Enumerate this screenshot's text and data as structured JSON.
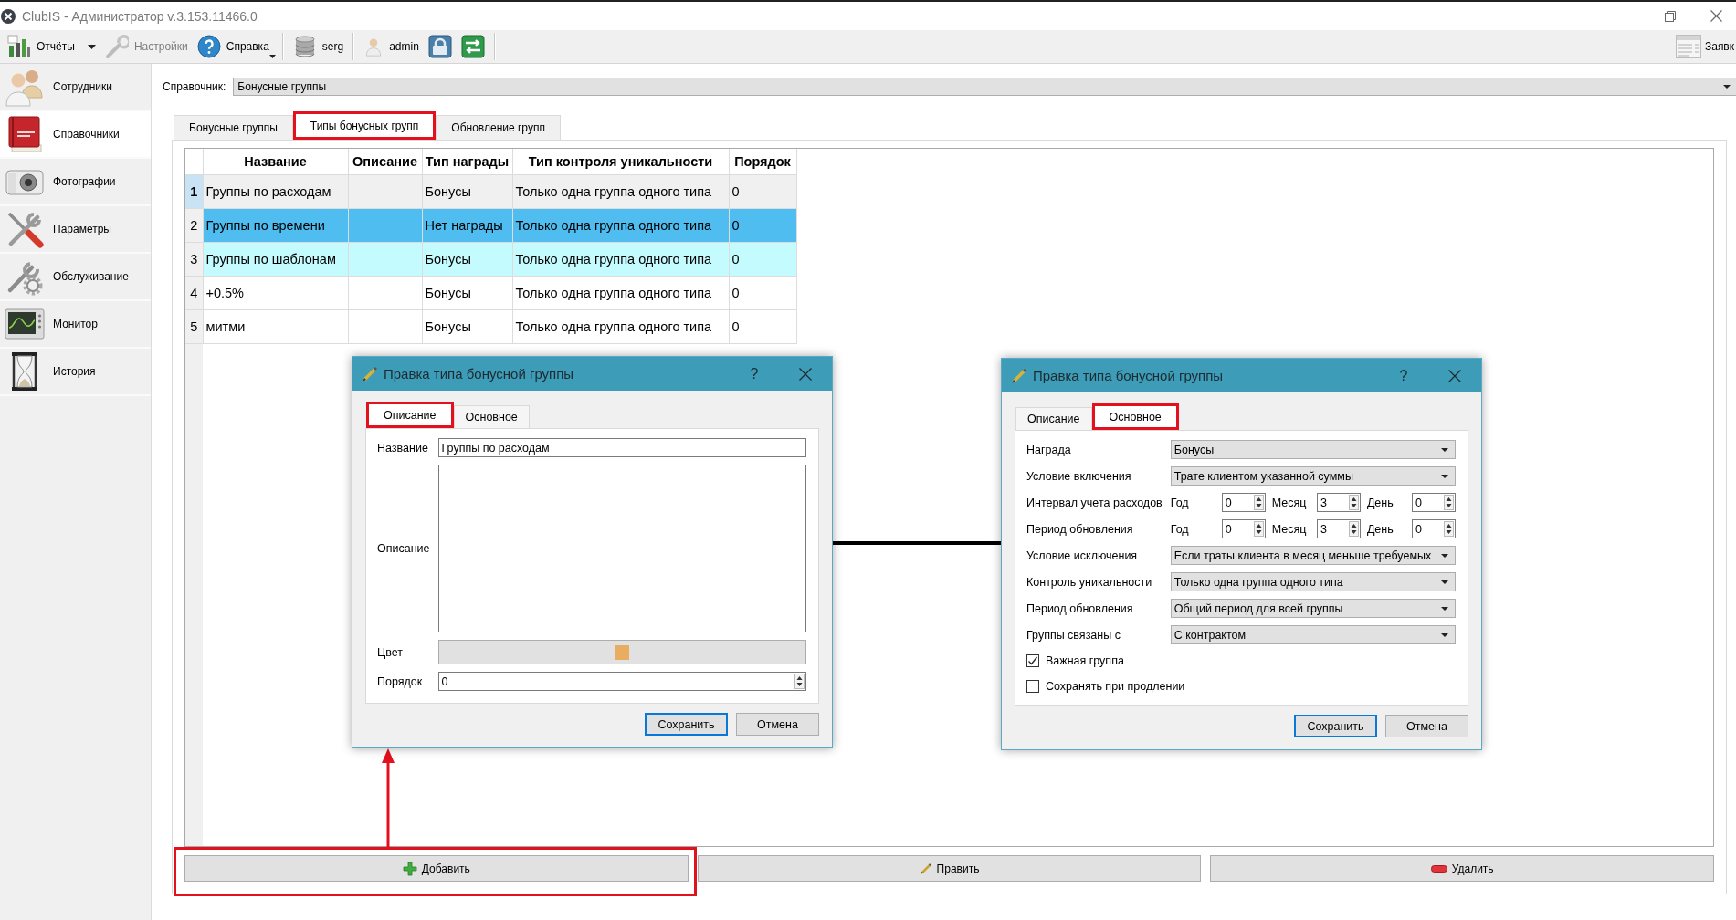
{
  "window": {
    "title": "ClubIS - Администратор v.3.153.11466.0"
  },
  "toolbar": {
    "items": [
      {
        "kind": "dropdown",
        "label": "Отчёты",
        "disabled": false,
        "separator_after": false
      },
      {
        "kind": "button",
        "label": "Настройки",
        "disabled": true,
        "separator_after": false
      },
      {
        "kind": "menu",
        "label": "Справка",
        "disabled": false,
        "separator_after": true
      },
      {
        "kind": "button",
        "label": "serg",
        "disabled": false,
        "separator_after": true
      },
      {
        "kind": "button",
        "label": "admin",
        "disabled": false,
        "separator_after": false
      },
      {
        "kind": "icon",
        "disabled": false,
        "separator_after": false
      },
      {
        "kind": "icon",
        "disabled": false,
        "separator_after": true
      }
    ],
    "right_item": {
      "label": "Заявк"
    }
  },
  "sidebar": {
    "items": [
      {
        "label": "Сотрудники",
        "selected": false
      },
      {
        "label": "Справочники",
        "selected": true
      },
      {
        "label": "Фотографии",
        "selected": false
      },
      {
        "label": "Параметры",
        "selected": false
      },
      {
        "label": "Обслуживание",
        "selected": false
      },
      {
        "label": "Монитор",
        "selected": false
      },
      {
        "label": "История",
        "selected": false
      }
    ]
  },
  "directory": {
    "label": "Справочник:",
    "value": "Бонусные группы"
  },
  "tabs": [
    {
      "label": "Бонусные группы",
      "selected": false,
      "highlighted": false
    },
    {
      "label": "Типы бонусных групп",
      "selected": true,
      "highlighted": true
    },
    {
      "label": "Обновление групп",
      "selected": false,
      "highlighted": false
    }
  ],
  "table": {
    "columns": [
      "Название",
      "Описание",
      "Тип награды",
      "Тип контроля уникальности",
      "Порядок"
    ],
    "rows": [
      {
        "number": "1",
        "name": "Группы по расходам",
        "reward_type": "Бонусы",
        "uniqueness_control": "Только одна группа одного типа",
        "order": "0",
        "current": true,
        "selected": false,
        "hover": false
      },
      {
        "number": "2",
        "name": "Группы по времени",
        "reward_type": "Нет награды",
        "uniqueness_control": "Только одна группа одного типа",
        "order": "0",
        "current": false,
        "selected": true,
        "hover": false
      },
      {
        "number": "3",
        "name": "Группы по шаблонам",
        "reward_type": "Бонусы",
        "uniqueness_control": "Только одна группа одного типа",
        "order": "0",
        "current": false,
        "selected": false,
        "hover": true
      },
      {
        "number": "4",
        "name": "+0.5%",
        "reward_type": "Бонусы",
        "uniqueness_control": "Только одна группа одного типа",
        "order": "0",
        "current": false,
        "selected": false,
        "hover": false
      },
      {
        "number": "5",
        "name": "митми",
        "reward_type": "Бонусы",
        "uniqueness_control": "Только одна группа одного типа",
        "order": "0",
        "current": false,
        "selected": false,
        "hover": false
      }
    ]
  },
  "buttons": [
    {
      "label": "Добавить",
      "highlighted": true
    },
    {
      "label": "Править",
      "highlighted": false
    },
    {
      "label": "Удалить",
      "highlighted": false
    }
  ],
  "dialogs": [
    {
      "title": "Правка типа бонусной группы",
      "help": "?",
      "tabs": [
        {
          "label": "Описание",
          "selected": true,
          "highlighted": true
        },
        {
          "label": "Основное",
          "selected": false,
          "highlighted": false
        }
      ],
      "fields": [
        {
          "kind": "text",
          "label": "Название",
          "value": "Группы по расходам"
        },
        {
          "kind": "textarea",
          "label": "Описание"
        },
        {
          "kind": "color",
          "label": "Цвет",
          "color": "#e8ad60"
        },
        {
          "kind": "spin",
          "label": "Порядок",
          "value": "0"
        }
      ],
      "buttons": [
        {
          "label": "Сохранить",
          "default": true
        },
        {
          "label": "Отмена",
          "default": false
        }
      ]
    },
    {
      "title": "Правка типа бонусной группы",
      "help": "?",
      "tabs": [
        {
          "label": "Описание",
          "selected": false,
          "highlighted": false
        },
        {
          "label": "Основное",
          "selected": true,
          "highlighted": true
        }
      ],
      "fields": [
        {
          "kind": "combo",
          "label": "Награда",
          "value": "Бонусы"
        },
        {
          "kind": "combo",
          "label": "Условие включения",
          "value": "Трате клиентом указанной суммы"
        },
        {
          "kind": "interval",
          "label": "Интервал учета расходов",
          "parts": [
            {
              "label": "Год",
              "value": "0"
            },
            {
              "label": "Месяц",
              "value": "3"
            },
            {
              "label": "День",
              "value": "0"
            }
          ]
        },
        {
          "kind": "interval",
          "label": "Период обновления",
          "parts": [
            {
              "label": "Год",
              "value": "0"
            },
            {
              "label": "Месяц",
              "value": "3"
            },
            {
              "label": "День",
              "value": "0"
            }
          ]
        },
        {
          "kind": "combo",
          "label": "Условие исключения",
          "value": "Если траты клиента в месяц меньше требуемых"
        },
        {
          "kind": "combo",
          "label": "Контроль уникальности",
          "value": "Только одна группа одного типа"
        },
        {
          "kind": "combo",
          "label": "Период обновления",
          "value": "Общий период для всей группы"
        },
        {
          "kind": "combo",
          "label": "Группы связаны с",
          "value": "С контрактом"
        },
        {
          "kind": "checkbox",
          "label": "Важная группа",
          "checked": true
        },
        {
          "kind": "checkbox",
          "label": "Сохранять при продлении",
          "checked": false
        }
      ],
      "buttons": [
        {
          "label": "Сохранить",
          "default": true
        },
        {
          "label": "Отмена",
          "default": false
        }
      ]
    }
  ]
}
